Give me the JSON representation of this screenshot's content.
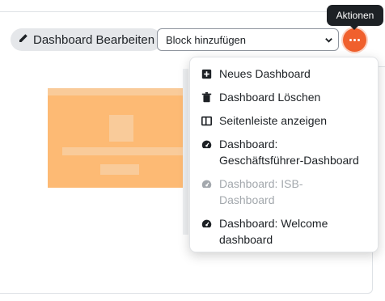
{
  "toolbar": {
    "edit_label": "Dashboard Bearbeiten",
    "block_select_value": "Block hinzufügen",
    "actions_tooltip": "Aktionen"
  },
  "menu": {
    "items": [
      {
        "label": "Neues Dashboard",
        "icon": "plus-square-icon",
        "disabled": false
      },
      {
        "label": "Dashboard Löschen",
        "icon": "trash-icon",
        "disabled": false
      },
      {
        "label": "Seitenleiste anzeigen",
        "icon": "sidebar-icon",
        "disabled": false
      },
      {
        "label_line1": "Dashboard:",
        "label_line2": "Geschäftsführer-Dashboard",
        "icon": "gauge-icon",
        "disabled": false
      },
      {
        "label_line1": "Dashboard: ISB-",
        "label_line2": "Dashboard",
        "icon": "gauge-icon",
        "disabled": true
      },
      {
        "label_line1": "Dashboard: Welcome",
        "label_line2": "dashboard",
        "icon": "gauge-icon",
        "disabled": false
      }
    ]
  },
  "colors": {
    "accent": "#f0602d",
    "block_card": "#fdba74",
    "tooltip_bg": "#1d2125"
  }
}
